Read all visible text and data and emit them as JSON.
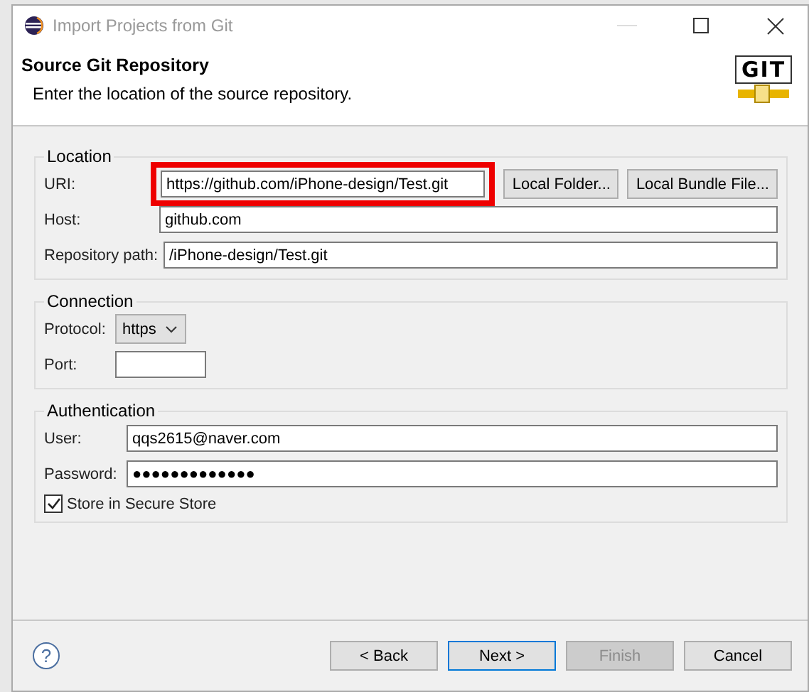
{
  "window": {
    "title": "Import Projects from Git"
  },
  "header": {
    "title": "Source Git Repository",
    "description": "Enter the location of the source repository.",
    "logo": "GIT"
  },
  "location": {
    "legend": "Location",
    "uri": {
      "label": "URI:",
      "value": "https://github.com/iPhone-design/Test.git",
      "highlighted": true
    },
    "local_folder_button": "Local Folder...",
    "local_bundle_button": "Local Bundle File...",
    "host": {
      "label": "Host:",
      "value": "github.com"
    },
    "repository_path": {
      "label": "Repository path:",
      "value": "/iPhone-design/Test.git"
    }
  },
  "connection": {
    "legend": "Connection",
    "protocol": {
      "label": "Protocol:",
      "value": "https"
    },
    "port": {
      "label": "Port:"
    }
  },
  "authentication": {
    "legend": "Authentication",
    "user": {
      "label": "User:",
      "value": "qqs2615@naver.com"
    },
    "password": {
      "label": "Password:",
      "value": "●●●●●●●●●●●●●"
    },
    "store": {
      "label": "Store in Secure Store",
      "checked": true
    }
  },
  "help": "?",
  "buttons": [
    {
      "label": "< Back",
      "disabled": false,
      "default": false
    },
    {
      "label": "Next >",
      "disabled": false,
      "default": true
    },
    {
      "label": "Finish",
      "disabled": true,
      "default": false
    },
    {
      "label": "Cancel",
      "disabled": false,
      "default": false
    }
  ]
}
